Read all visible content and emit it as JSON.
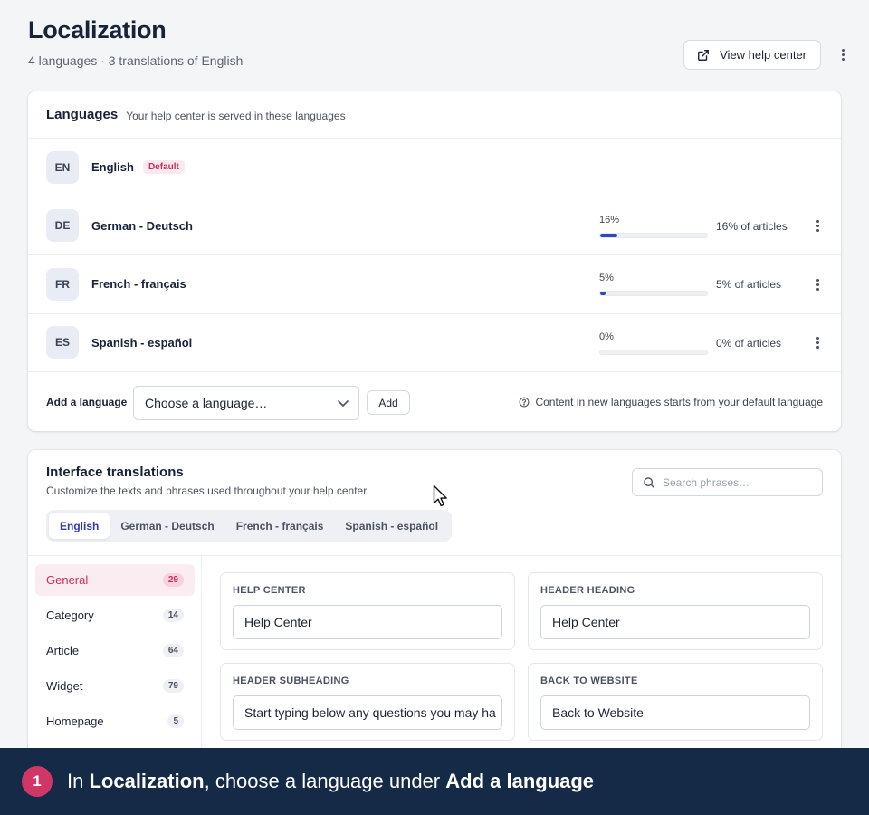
{
  "page": {
    "title": "Localization",
    "subtitle": "4 languages · 3 translations of English",
    "view_help_center": "View help center"
  },
  "languages_card": {
    "title": "Languages",
    "description": "Your help center is served in these languages",
    "rows": [
      {
        "code": "EN",
        "name": "English",
        "badge": "Default"
      },
      {
        "code": "DE",
        "name": "German - Deutsch",
        "percent_label": "16%",
        "progress": 0.16,
        "articles": "16% of articles"
      },
      {
        "code": "FR",
        "name": "French - français",
        "percent_label": "5%",
        "progress": 0.05,
        "articles": "5% of articles"
      },
      {
        "code": "ES",
        "name": "Spanish - español",
        "percent_label": "0%",
        "progress": 0.0,
        "articles": "0% of articles"
      }
    ],
    "add": {
      "label": "Add a language",
      "select_value": "Choose a language…",
      "button": "Add",
      "hint": "Content in new languages starts from your default language"
    }
  },
  "interface_card": {
    "title": "Interface translations",
    "description": "Customize the texts and phrases used throughout your help center.",
    "search_placeholder": "Search phrases…",
    "tabs": [
      "English",
      "German - Deutsch",
      "French - français",
      "Spanish - español"
    ],
    "categories": [
      {
        "name": "General",
        "count": "29"
      },
      {
        "name": "Category",
        "count": "14"
      },
      {
        "name": "Article",
        "count": "64"
      },
      {
        "name": "Widget",
        "count": "79"
      },
      {
        "name": "Homepage",
        "count": "5"
      }
    ],
    "fields": [
      {
        "label": "HELP CENTER",
        "value": "Help Center"
      },
      {
        "label": "HEADER HEADING",
        "value": "Help Center"
      },
      {
        "label": "HEADER SUBHEADING",
        "value": "Start typing below any questions you may ha"
      },
      {
        "label": "BACK TO WEBSITE",
        "value": "Back to Website"
      }
    ]
  },
  "banner": {
    "step": "1",
    "text_1": "In ",
    "bold_1": "Localization",
    "text_2": ", choose a language under ",
    "bold_2": "Add a language"
  },
  "colors": {
    "accent": "#3344c9",
    "pink": "#c2315b",
    "banner_bg": "#142a46"
  },
  "icons": [
    "external-link-icon",
    "more-vertical-icon",
    "chevron-down-icon",
    "help-circle-icon",
    "search-icon",
    "mouse-pointer-icon"
  ]
}
